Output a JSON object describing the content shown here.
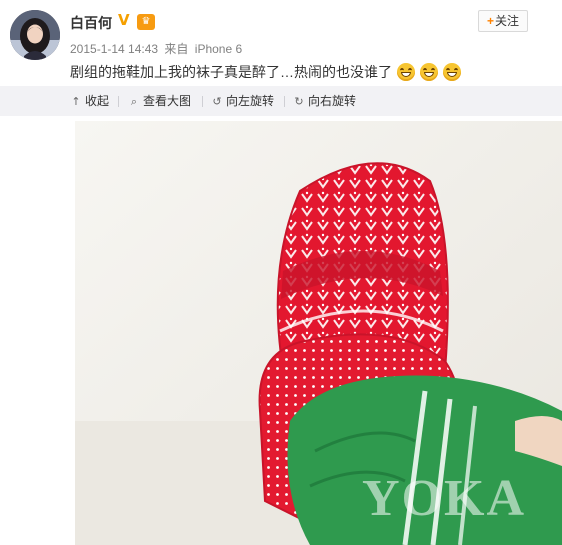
{
  "post": {
    "author": "白百何",
    "follow_label": "关注",
    "follow_plus": "+",
    "timestamp": "2015-1-14 14:43",
    "source_prefix": "来自",
    "source": "iPhone 6",
    "text": "剧组的拖鞋加上我的袜子真是醉了…热闹的也没谁了",
    "emoji": [
      "laugh-cry",
      "laugh-cry",
      "laugh-cry"
    ]
  },
  "toolbar": {
    "items": [
      {
        "icon": "collapse-icon",
        "glyph": "↑",
        "label": "收起"
      },
      {
        "icon": "magnify-icon",
        "glyph": "⌕",
        "label": "查看大图"
      },
      {
        "icon": "rotate-left-icon",
        "glyph": "↺",
        "label": "向左旋转"
      },
      {
        "icon": "rotate-right-icon",
        "glyph": "↻",
        "label": "向右旋转"
      }
    ]
  },
  "photo": {
    "watermark": "YOKA"
  },
  "colors": {
    "accent_orange": "#ff8200",
    "sock_green": "#2f9a4e",
    "slipper_red": "#e3172f",
    "toolbar_bg": "#f2f2f5"
  }
}
